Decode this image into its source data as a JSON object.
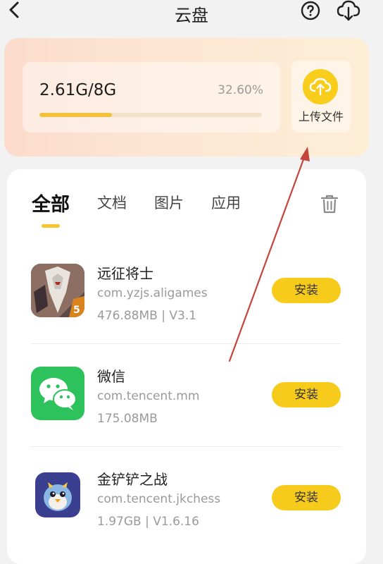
{
  "header": {
    "title": "云盘",
    "back_icon": "chevron-left-icon",
    "help_icon": "question-circle-icon",
    "cloud_icon": "cloud-download-icon"
  },
  "storage": {
    "usage_text": "2.61G/8G",
    "percent_text": "32.60%",
    "percent_value": 32.6,
    "upload_label": "上传文件",
    "accent_color": "#f7cb1c"
  },
  "tabs": [
    {
      "label": "全部",
      "active": true
    },
    {
      "label": "文档",
      "active": false
    },
    {
      "label": "图片",
      "active": false
    },
    {
      "label": "应用",
      "active": false
    }
  ],
  "apps": [
    {
      "name": "远征将士",
      "package": "com.yzjs.aligames",
      "size": "476.88MB | V3.1",
      "button": "安装",
      "icon": "game-mecha-icon"
    },
    {
      "name": "微信",
      "package": "com.tencent.mm",
      "size": "175.08MB",
      "button": "安装",
      "icon": "wechat-icon"
    },
    {
      "name": "金铲铲之战",
      "package": "com.tencent.jkchess",
      "size": "1.97GB | V1.6.16",
      "button": "安装",
      "icon": "game-penguin-icon"
    }
  ]
}
